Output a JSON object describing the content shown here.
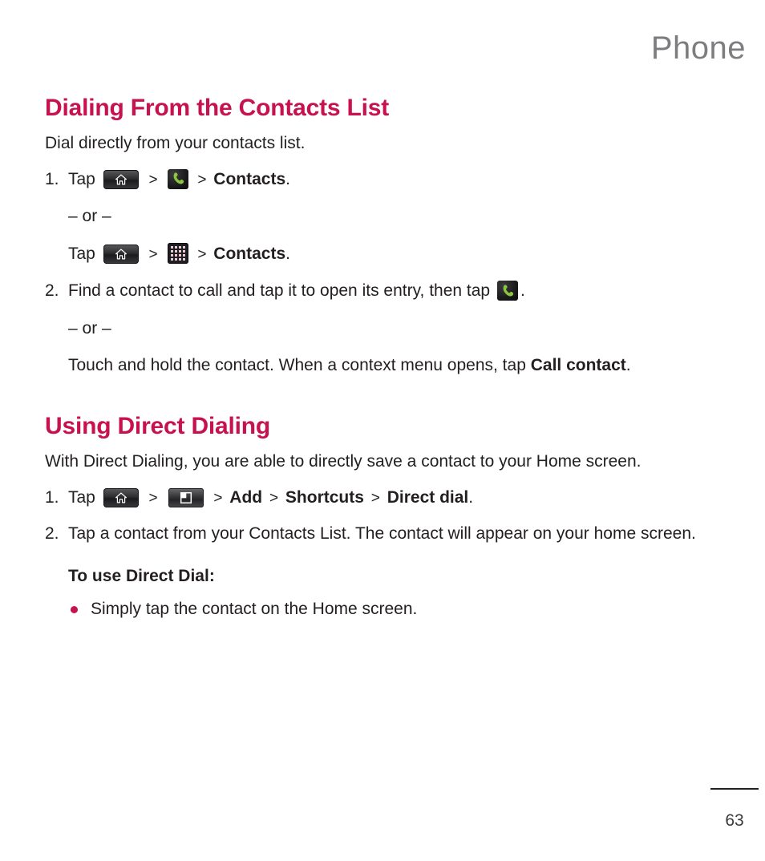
{
  "page": {
    "running_head": "Phone",
    "folio": "63",
    "accent_color": "#c8114f",
    "running_head_color": "#7d7d80",
    "text_color": "#231f20"
  },
  "sections": [
    {
      "title": "Dialing From the Contacts List",
      "intro": "Dial directly from your contacts list.",
      "step1": {
        "num": "1.",
        "tap": "Tap",
        "chev1": ">",
        "chev2": ">",
        "target": "Contacts",
        "period": ".",
        "icon_home": "home-key-icon",
        "icon_phone": "phone-app-icon"
      },
      "or_1": "– or –",
      "alt1": {
        "tap": "Tap",
        "chev1": ">",
        "chev2": ">",
        "target": "Contacts",
        "period": ".",
        "icon_home": "home-key-icon",
        "icon_apps": "apps-launcher-icon"
      },
      "step2": {
        "num": "2.",
        "text_before": "Find a contact to call and tap it to open its entry, then tap",
        "icon_phone": "phone-app-icon",
        "period": "."
      },
      "or_2": "– or –",
      "alt2": {
        "text_before": "Touch and hold the contact. When a context menu opens, tap ",
        "bold": "Call contact",
        "period": "."
      }
    },
    {
      "title": "Using Direct Dialing",
      "intro": "With Direct Dialing, you are able to directly save a contact to your Home screen.",
      "step1": {
        "num": "1.",
        "tap": "Tap",
        "chev1": ">",
        "chev2": ">",
        "chev3": ">",
        "chev4": ">",
        "add": "Add",
        "shortcuts": "Shortcuts",
        "direct_dial": "Direct dial",
        "period": ".",
        "icon_home": "home-key-icon",
        "icon_menu": "menu-key-icon"
      },
      "step2": {
        "num": "2.",
        "text": "Tap a contact from your Contacts List. The contact will appear on your home screen."
      },
      "subhead": "To use Direct Dial:",
      "bullets": [
        "Simply tap the contact on the Home screen."
      ]
    }
  ]
}
